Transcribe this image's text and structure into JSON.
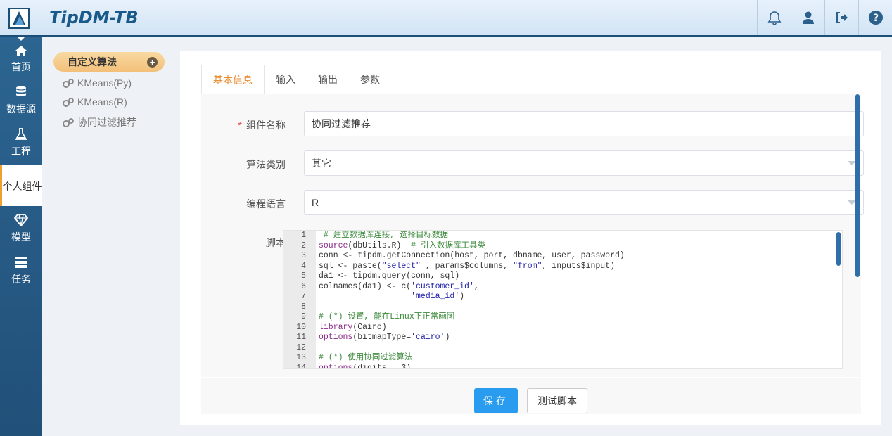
{
  "app": {
    "title": "TipDM-TB"
  },
  "topbar": {
    "icons": [
      "bell-icon",
      "user-icon",
      "logout-icon",
      "help-icon"
    ]
  },
  "leftnav": {
    "items": [
      {
        "label": "首页",
        "icon": "home-icon"
      },
      {
        "label": "数据源",
        "icon": "database-icon"
      },
      {
        "label": "工程",
        "icon": "flask-icon"
      },
      {
        "label": "个人组件",
        "icon": ""
      },
      {
        "label": "模型",
        "icon": "diamond-icon"
      },
      {
        "label": "任务",
        "icon": "tasks-icon"
      }
    ],
    "active_index": 3
  },
  "sidebar": {
    "header": "自定义算法",
    "items": [
      {
        "label": "KMeans(Py)",
        "icon": "cogs-icon"
      },
      {
        "label": "KMeans(R)",
        "icon": "cogs-icon"
      },
      {
        "label": "协同过滤推荐",
        "icon": "cogs-icon"
      }
    ]
  },
  "tabs": [
    {
      "label": "基本信息",
      "active": true
    },
    {
      "label": "输入",
      "active": false
    },
    {
      "label": "输出",
      "active": false
    },
    {
      "label": "参数",
      "active": false
    }
  ],
  "form": {
    "name_label": "组件名称",
    "name_value": "协同过滤推荐",
    "category_label": "算法类别",
    "category_value": "其它",
    "language_label": "编程语言",
    "language_value": "R",
    "script_label": "脚本"
  },
  "code_lines": [
    {
      "n": "1",
      "t": " # 建立数据库连接, 选择目标数据"
    },
    {
      "n": "2",
      "t": "source(dbUtils.R)  # 引入数据库工具类"
    },
    {
      "n": "3",
      "t": "conn <- tipdm.getConnection(host, port, dbname, user, password)"
    },
    {
      "n": "4",
      "t": "sql <- paste(\"select\" , params$columns, \"from\", inputs$input)"
    },
    {
      "n": "5",
      "t": "da1 <- tipdm.query(conn, sql)"
    },
    {
      "n": "6",
      "t": "colnames(da1) <- c('customer_id',"
    },
    {
      "n": "7",
      "t": "                   'media_id')"
    },
    {
      "n": "8",
      "t": ""
    },
    {
      "n": "9",
      "t": "# (*) 设置, 能在Linux下正常画图"
    },
    {
      "n": "10",
      "t": "library(Cairo)"
    },
    {
      "n": "11",
      "t": "options(bitmapType='cairo')"
    },
    {
      "n": "12",
      "t": ""
    },
    {
      "n": "13",
      "t": "# (*) 使用协同过滤算法"
    },
    {
      "n": "14",
      "t": "options(digits = 3)"
    }
  ],
  "buttons": {
    "save": "保存",
    "test": "测试脚本"
  },
  "colors": {
    "accent": "#e8892a",
    "primary": "#2a9cf0",
    "nav_bg": "#245a86"
  }
}
